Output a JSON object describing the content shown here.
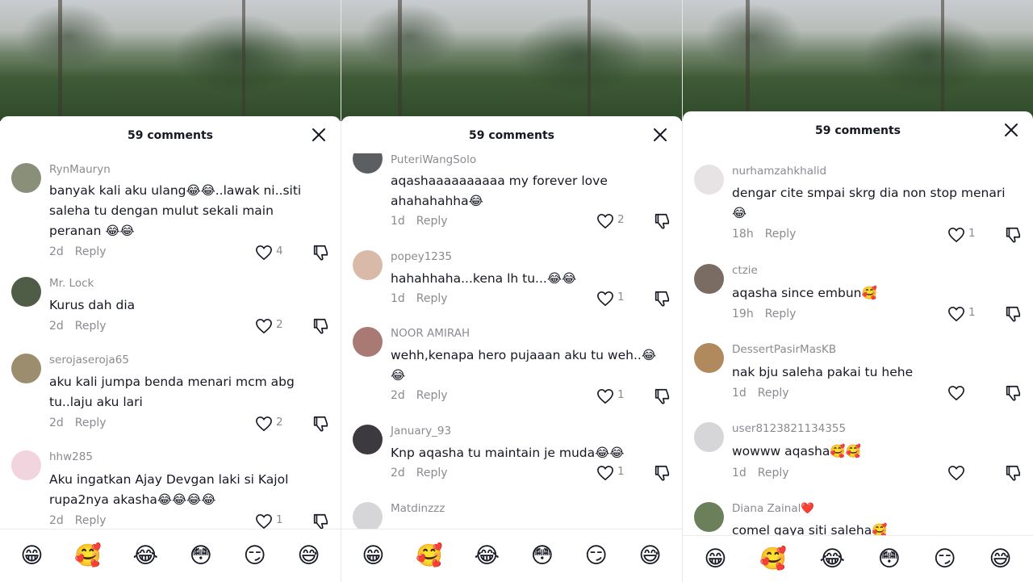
{
  "panels": [
    {
      "header": {
        "title": "59 comments"
      },
      "comments": [
        {
          "username": "RynMauryn",
          "text": "banyak kali aku ulang😂😂..lawak ni..siti saleha tu dengan mulut sekali main peranan 😂😂",
          "time": "2d",
          "reply": "Reply",
          "likes": "4",
          "avatar_color": "#8a8f7a"
        },
        {
          "username": "Mr. Lock",
          "text": "Kurus dah dia",
          "time": "2d",
          "reply": "Reply",
          "likes": "2",
          "avatar_color": "#4f5d46"
        },
        {
          "username": "serojaseroja65",
          "text": "aku kali jumpa benda menari mcm abg tu..laju aku lari",
          "time": "2d",
          "reply": "Reply",
          "likes": "2",
          "avatar_color": "#9c8d6e"
        },
        {
          "username": "hhw285",
          "text": "Aku ingatkan Ajay Devgan laki si Kajol rupa2nya akasha😂😂😂😂",
          "time": "2d",
          "reply": "Reply",
          "likes": "1",
          "avatar_color": "#f1d4dd"
        }
      ],
      "emojis": [
        "😁",
        "🥰",
        "😂",
        "😳",
        "😏",
        "😅"
      ]
    },
    {
      "header": {
        "title": "59 comments"
      },
      "comments": [
        {
          "username": "PuteriWangSolo",
          "text": "aqashaaaaaaaaaa my forever love ahahahahha😂",
          "time": "1d",
          "reply": "Reply",
          "likes": "2",
          "avatar_color": "#5b5f62"
        },
        {
          "username": "popey1235",
          "text": "hahahhaha...kena lh tu...😂😂",
          "time": "1d",
          "reply": "Reply",
          "likes": "1",
          "avatar_color": "#d9b9a8"
        },
        {
          "username": "NOOR AMIRAH",
          "text": "wehh,kenapa hero pujaaan aku tu weh..😂😂",
          "time": "2d",
          "reply": "Reply",
          "likes": "1",
          "avatar_color": "#a97a73"
        },
        {
          "username": "January_93",
          "text": "Knp aqasha tu maintain je muda😂😂",
          "time": "2d",
          "reply": "Reply",
          "likes": "1",
          "avatar_color": "#3d3a3f"
        },
        {
          "username": "Matdinzzz",
          "text": "",
          "time": "",
          "reply": "",
          "likes": "",
          "avatar_color": "#d6d6d8"
        }
      ],
      "emojis": [
        "😁",
        "🥰",
        "😂",
        "😳",
        "😏",
        "😅"
      ]
    },
    {
      "header": {
        "title": "59 comments"
      },
      "comments": [
        {
          "username": "nurhamzahkhalid",
          "text": "dengar cite smpai skrg dia non stop menari 😂",
          "time": "18h",
          "reply": "Reply",
          "likes": "1",
          "avatar_color": "#e7e2e3"
        },
        {
          "username": "ctzie",
          "text": "aqasha since embun🥰",
          "time": "19h",
          "reply": "Reply",
          "likes": "1",
          "avatar_color": "#7a6b63"
        },
        {
          "username": "DessertPasirMasKB",
          "text": "nak bju saleha pakai tu hehe",
          "time": "1d",
          "reply": "Reply",
          "likes": "",
          "avatar_color": "#b08a5c"
        },
        {
          "username": "user8123821134355",
          "text": "wowww aqasha🥰🥰",
          "time": "1d",
          "reply": "Reply",
          "likes": "",
          "avatar_color": "#d6d6d8"
        },
        {
          "username": "Diana Zainal❤️",
          "text": "comel gaya siti saleha🥰",
          "time": "",
          "reply": "",
          "likes": "",
          "avatar_color": "#6b7f5a"
        }
      ],
      "emojis": [
        "😁",
        "🥰",
        "😂",
        "😳",
        "😏",
        "😅"
      ]
    }
  ]
}
